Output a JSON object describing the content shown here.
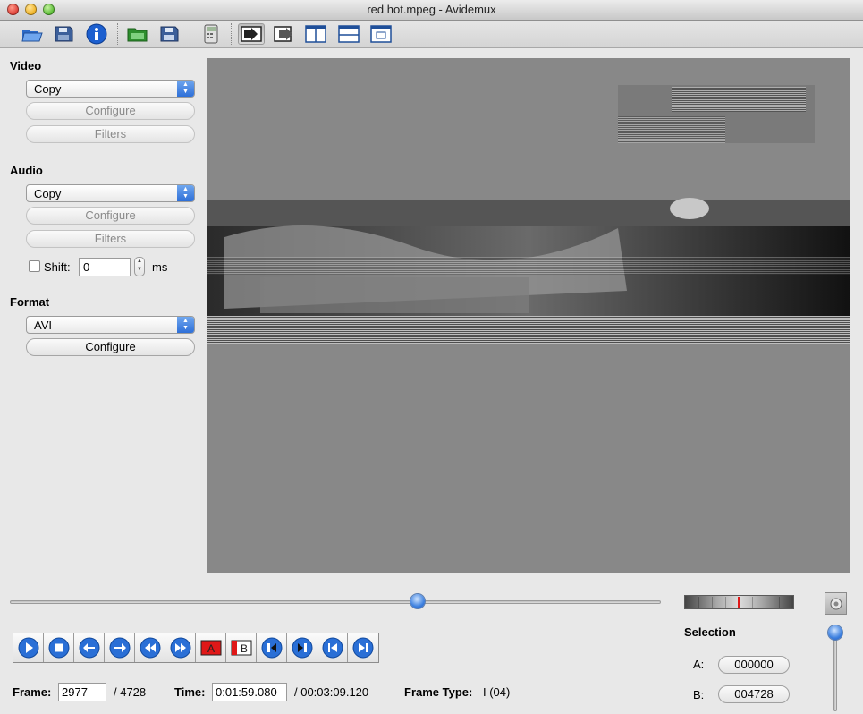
{
  "window": {
    "title": "red hot.mpeg - Avidemux"
  },
  "toolbar": {
    "buttons": [
      {
        "name": "open-icon"
      },
      {
        "name": "save-icon"
      },
      {
        "name": "info-icon"
      },
      {
        "name": "open-folder-icon"
      },
      {
        "name": "save-video-icon"
      },
      {
        "name": "calculator-icon"
      },
      {
        "name": "input-view-icon"
      },
      {
        "name": "output-view-icon"
      },
      {
        "name": "side-by-side-view-icon"
      },
      {
        "name": "top-bottom-view-icon"
      },
      {
        "name": "separate-window-view-icon"
      }
    ]
  },
  "video": {
    "title": "Video",
    "codec": "Copy",
    "configure_label": "Configure",
    "filters_label": "Filters"
  },
  "audio": {
    "title": "Audio",
    "codec": "Copy",
    "configure_label": "Configure",
    "filters_label": "Filters",
    "shift_label": "Shift:",
    "shift_value": "0",
    "shift_unit": "ms",
    "shift_enabled": false
  },
  "format": {
    "title": "Format",
    "container": "AVI",
    "configure_label": "Configure"
  },
  "timeline": {
    "position_fraction": 0.626
  },
  "transport": {
    "buttons": [
      "play-icon",
      "stop-icon",
      "previous-frame-icon",
      "next-frame-icon",
      "rewind-icon",
      "fast-forward-icon",
      "set-marker-a-icon",
      "set-marker-b-icon",
      "previous-keyframe-icon",
      "next-keyframe-icon",
      "goto-start-icon",
      "goto-end-icon"
    ]
  },
  "selection": {
    "title": "Selection",
    "a_label": "A:",
    "a_value": "000000",
    "b_label": "B:",
    "b_value": "004728"
  },
  "status": {
    "frame_label": "Frame:",
    "frame_value": "2977",
    "frame_total": "/ 4728",
    "time_label": "Time:",
    "time_value": "0:01:59.080",
    "time_total": "/ 00:03:09.120",
    "frame_type_label": "Frame Type:",
    "frame_type_value": "I (04)"
  },
  "colors": {
    "accent": "#2e6fd8",
    "preview_background": "#888888",
    "marker_a": "#e01818"
  }
}
